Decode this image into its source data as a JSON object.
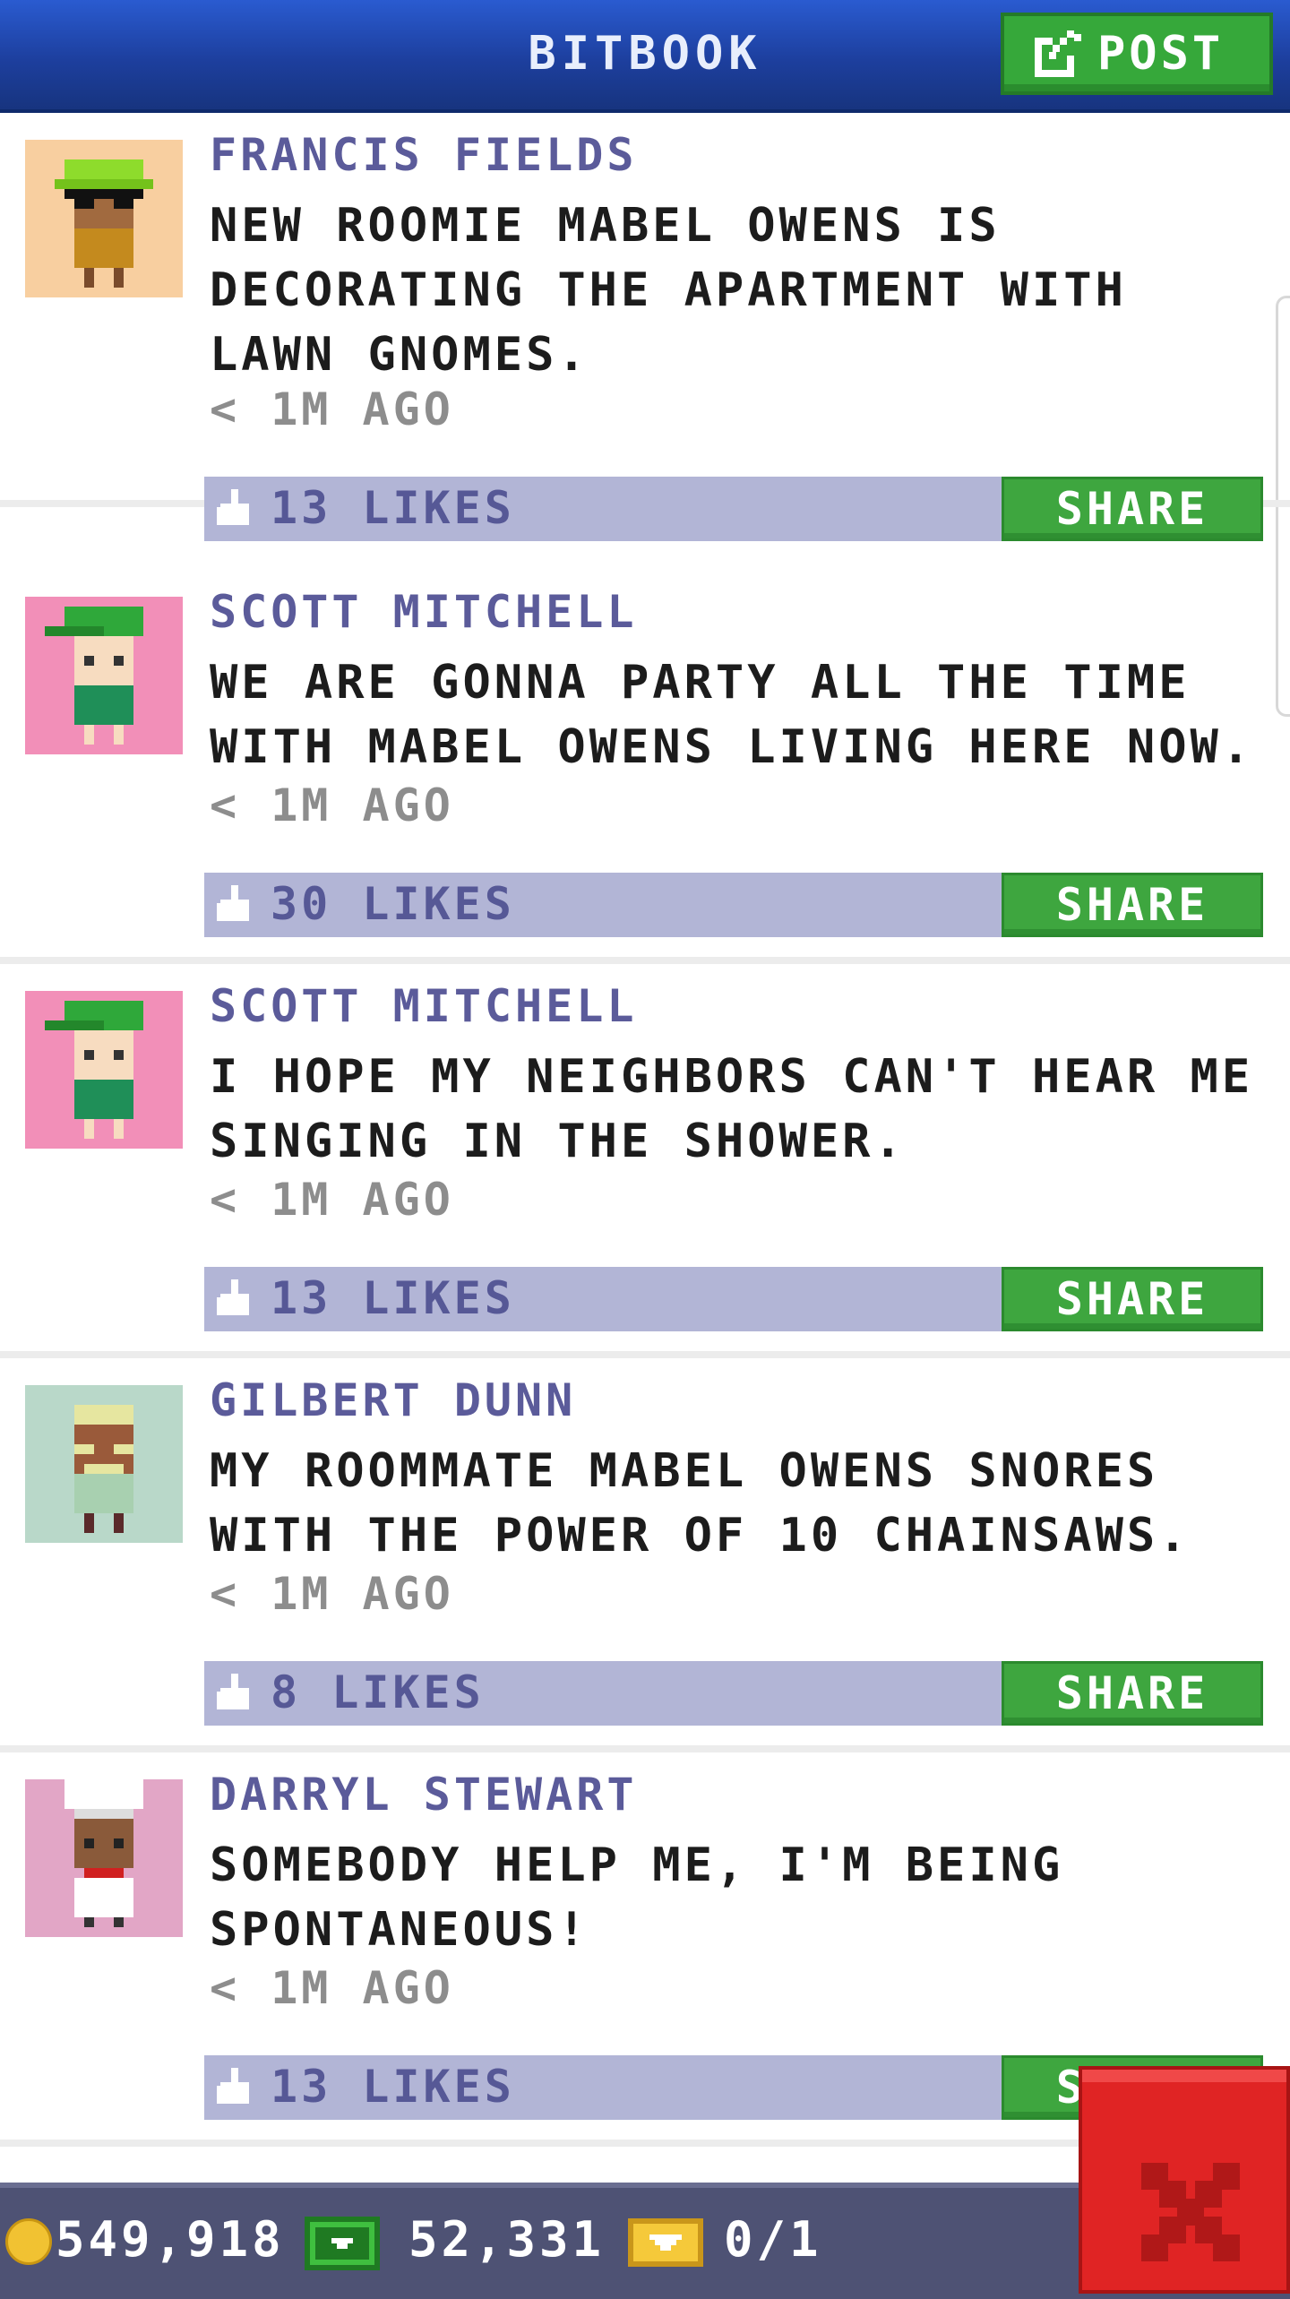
{
  "app": {
    "title": "BITBOOK",
    "post_button_label": "POST"
  },
  "posts": [
    {
      "author": "FRANCIS FIELDS",
      "message": "NEW ROOMIE MABEL OWENS IS DECORATING THE APARTMENT WITH LAWN GNOMES.",
      "time": "< 1M AGO",
      "likes": "13 LIKES",
      "share_label": "SHARE",
      "avatar_bg": "#f8cfa0"
    },
    {
      "author": "SCOTT MITCHELL",
      "message": "WE ARE GONNA PARTY ALL THE TIME WITH MABEL OWENS LIVING HERE NOW.",
      "time": "< 1M AGO",
      "likes": "30 LIKES",
      "share_label": "SHARE",
      "avatar_bg": "#f28fb8"
    },
    {
      "author": "SCOTT MITCHELL",
      "message": "I HOPE MY NEIGHBORS CAN'T HEAR ME SINGING IN THE SHOWER.",
      "time": "< 1M AGO",
      "likes": "13 LIKES",
      "share_label": "SHARE",
      "avatar_bg": "#f28fb8"
    },
    {
      "author": "GILBERT DUNN",
      "message": "MY ROOMMATE MABEL OWENS SNORES WITH THE POWER OF 10 CHAINSAWS.",
      "time": "< 1M AGO",
      "likes": "8 LIKES",
      "share_label": "SHARE",
      "avatar_bg": "#b9d8c9"
    },
    {
      "author": "DARRYL STEWART",
      "message": "SOMEBODY HELP ME, I'M BEING SPONTANEOUS!",
      "time": "< 1M AGO",
      "likes": "13 LIKES",
      "share_label": "SHARE",
      "avatar_bg": "#e2a6c6"
    }
  ],
  "status": {
    "coins": "549,918",
    "bux": "52,331",
    "tickets": "0/1"
  },
  "icons": {
    "post": "edit-icon",
    "like": "thumbs-up-icon",
    "coin": "coin-icon",
    "bux": "cash-icon",
    "ticket": "ticket-icon",
    "close": "close-icon"
  },
  "colors": {
    "header": "#1d3f9e",
    "accent_green": "#3ea63f",
    "like_bar": "#b2b5d6",
    "author_text": "#5b5b9a",
    "close_red": "#e02424"
  }
}
